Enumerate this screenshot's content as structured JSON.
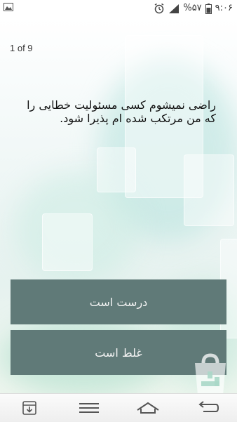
{
  "status_bar": {
    "time": "۹:۰۶",
    "battery_percent": "%۵۷",
    "icons": [
      "gallery-icon",
      "alarm-icon",
      "signal-icon",
      "battery-icon"
    ]
  },
  "quiz": {
    "counter": "1 of 9",
    "question": "راضی نمیشوم کسی مسئولیت خطایی را که من مرتکب شده ام پذیرا شود.",
    "answer_true": "درست است",
    "answer_false": "غلط است"
  },
  "nav_bar": {
    "buttons": [
      "download-icon",
      "menu-icon",
      "home-icon",
      "back-icon"
    ]
  },
  "colors": {
    "button_bg": "#607a78",
    "button_text": "#f4f4f4",
    "text": "#111111"
  }
}
